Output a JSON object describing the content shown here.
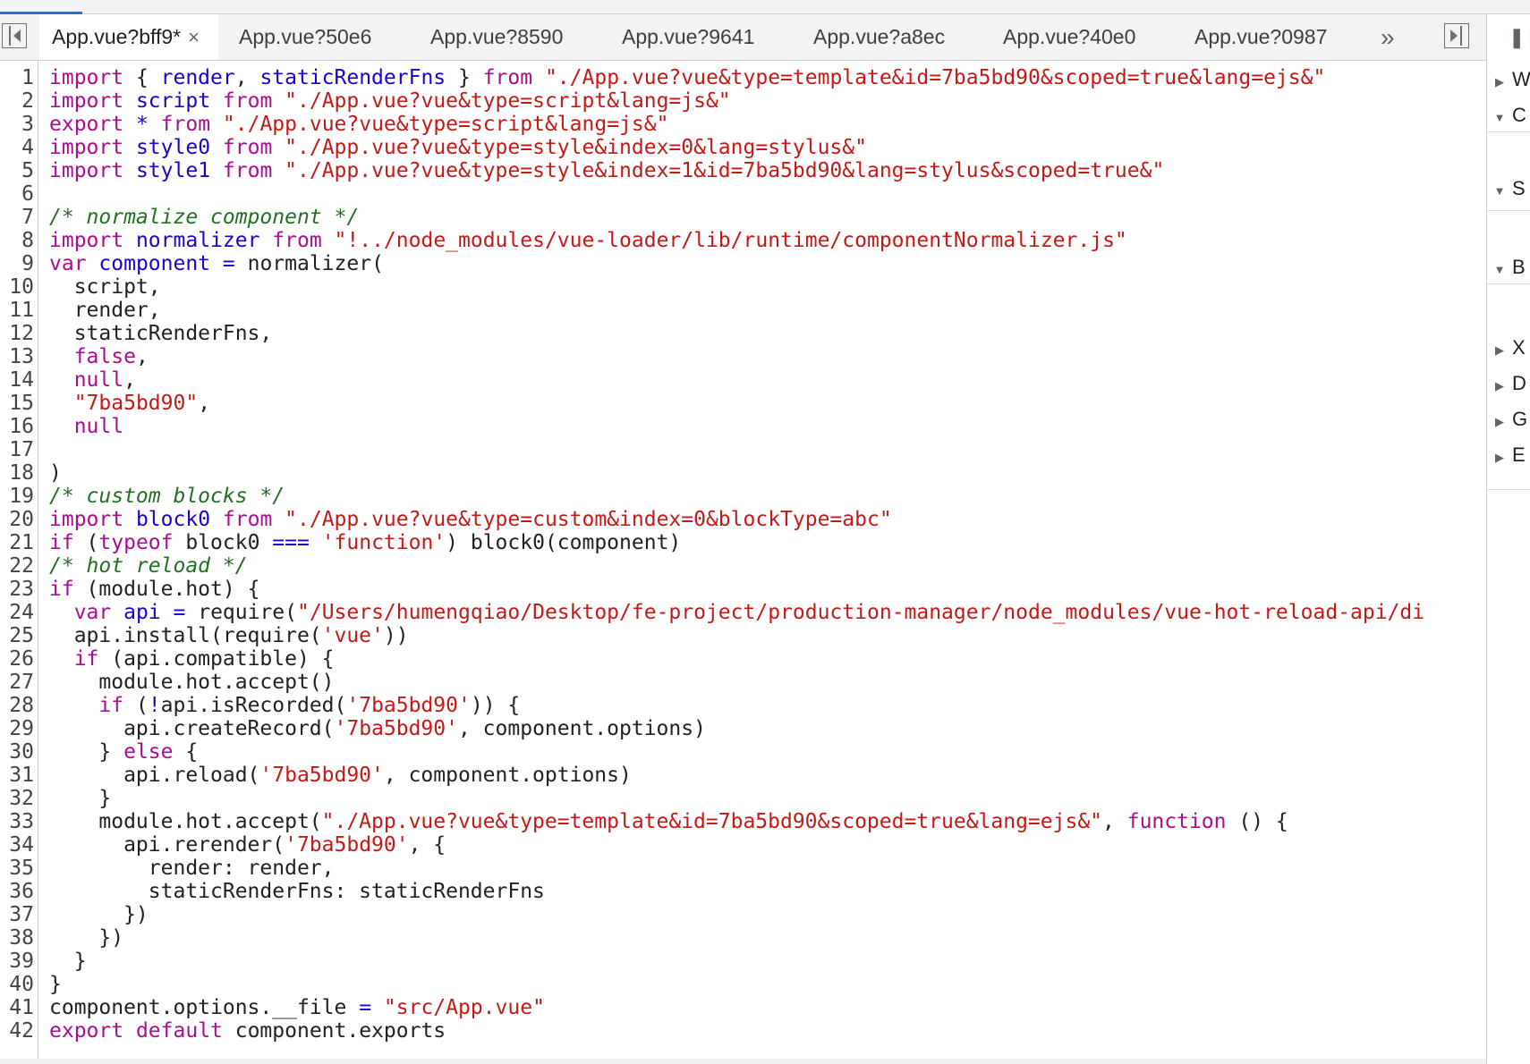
{
  "tabs": [
    {
      "label": "App.vue?bff9*",
      "active": true,
      "closable": true,
      "close": "×"
    },
    {
      "label": "App.vue?50e6"
    },
    {
      "label": "App.vue?8590"
    },
    {
      "label": "App.vue?9641"
    },
    {
      "label": "App.vue?a8ec"
    },
    {
      "label": "App.vue?40e0"
    },
    {
      "label": "App.vue?0987"
    }
  ],
  "more_tabs": "»",
  "right_pane": {
    "pause": "❚❚",
    "sections": [
      {
        "label": "W",
        "expanded": false
      },
      {
        "label": "C",
        "expanded": true
      },
      {
        "label": "S",
        "expanded": true
      },
      {
        "label": "B",
        "expanded": true
      },
      {
        "label": "X",
        "expanded": false
      },
      {
        "label": "D",
        "expanded": false
      },
      {
        "label": "G",
        "expanded": false
      },
      {
        "label": "E",
        "expanded": false
      }
    ]
  },
  "code_lines": [
    "import { render, staticRenderFns } from \"./App.vue?vue&type=template&id=7ba5bd90&scoped=true&lang=ejs&\"",
    "import script from \"./App.vue?vue&type=script&lang=js&\"",
    "export * from \"./App.vue?vue&type=script&lang=js&\"",
    "import style0 from \"./App.vue?vue&type=style&index=0&lang=stylus&\"",
    "import style1 from \"./App.vue?vue&type=style&index=1&id=7ba5bd90&lang=stylus&scoped=true&\"",
    "",
    "/* normalize component */",
    "import normalizer from \"!../node_modules/vue-loader/lib/runtime/componentNormalizer.js\"",
    "var component = normalizer(",
    "  script,",
    "  render,",
    "  staticRenderFns,",
    "  false,",
    "  null,",
    "  \"7ba5bd90\",",
    "  null",
    "  ",
    ")",
    "/* custom blocks */",
    "import block0 from \"./App.vue?vue&type=custom&index=0&blockType=abc\"",
    "if (typeof block0 === 'function') block0(component)",
    "/* hot reload */",
    "if (module.hot) {",
    "  var api = require(\"/Users/humengqiao/Desktop/fe-project/production-manager/node_modules/vue-hot-reload-api/di",
    "  api.install(require('vue'))",
    "  if (api.compatible) {",
    "    module.hot.accept()",
    "    if (!api.isRecorded('7ba5bd90')) {",
    "      api.createRecord('7ba5bd90', component.options)",
    "    } else {",
    "      api.reload('7ba5bd90', component.options)",
    "    }",
    "    module.hot.accept(\"./App.vue?vue&type=template&id=7ba5bd90&scoped=true&lang=ejs&\", function () {",
    "      api.rerender('7ba5bd90', {",
    "        render: render,",
    "        staticRenderFns: staticRenderFns",
    "      })",
    "    })",
    "  }",
    "}",
    "component.options.__file = \"src/App.vue\"",
    "export default component.exports"
  ]
}
